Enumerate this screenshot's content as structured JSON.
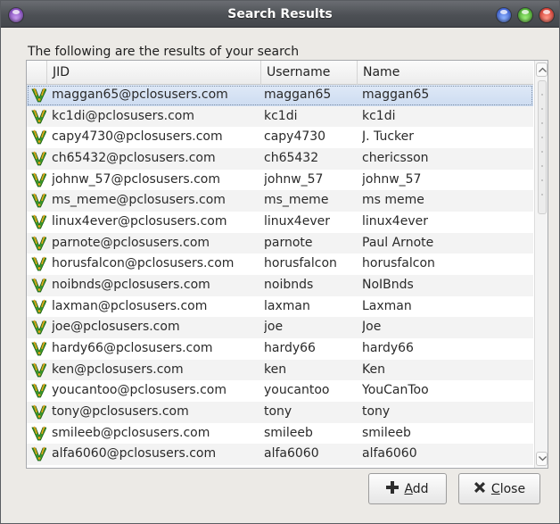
{
  "window": {
    "title": "Search Results"
  },
  "caption": "The following are the results of your search",
  "table": {
    "columns": [
      "JID",
      "Username",
      "Name"
    ],
    "rows": [
      {
        "jid": "maggan65@pclosusers.com",
        "username": "maggan65",
        "name": "maggan65",
        "selected": true
      },
      {
        "jid": "kc1di@pclosusers.com",
        "username": "kc1di",
        "name": "kc1di"
      },
      {
        "jid": "capy4730@pclosusers.com",
        "username": "capy4730",
        "name": "J. Tucker"
      },
      {
        "jid": "ch65432@pclosusers.com",
        "username": "ch65432",
        "name": "chericsson"
      },
      {
        "jid": "johnw_57@pclosusers.com",
        "username": "johnw_57",
        "name": "johnw_57"
      },
      {
        "jid": "ms_meme@pclosusers.com",
        "username": "ms_meme",
        "name": "ms meme"
      },
      {
        "jid": "linux4ever@pclosusers.com",
        "username": "linux4ever",
        "name": "linux4ever"
      },
      {
        "jid": "parnote@pclosusers.com",
        "username": "parnote",
        "name": "Paul Arnote"
      },
      {
        "jid": "horusfalcon@pclosusers.com",
        "username": "horusfalcon",
        "name": "horusfalcon"
      },
      {
        "jid": "noibnds@pclosusers.com",
        "username": "noibnds",
        "name": "NoIBnds"
      },
      {
        "jid": "laxman@pclosusers.com",
        "username": "laxman",
        "name": "Laxman"
      },
      {
        "jid": "joe@pclosusers.com",
        "username": "joe",
        "name": "Joe"
      },
      {
        "jid": "hardy66@pclosusers.com",
        "username": "hardy66",
        "name": "hardy66"
      },
      {
        "jid": "ken@pclosusers.com",
        "username": "ken",
        "name": "Ken"
      },
      {
        "jid": "youcantoo@pclosusers.com",
        "username": "youcantoo",
        "name": "YouCanToo"
      },
      {
        "jid": "tony@pclosusers.com",
        "username": "tony",
        "name": "tony"
      },
      {
        "jid": "smileeb@pclosusers.com",
        "username": "smileeb",
        "name": "smileeb"
      },
      {
        "jid": "alfa6060@pclosusers.com",
        "username": "alfa6060",
        "name": "alfa6060"
      }
    ]
  },
  "buttons": {
    "add": {
      "mnemonic": "A",
      "rest": "dd"
    },
    "close": {
      "mnemonic": "C",
      "rest": "lose"
    }
  },
  "icons": {
    "window_menu": "window-menu-icon",
    "minimize": "minimize-icon",
    "maximize": "maximize-icon",
    "close": "close-icon",
    "row": "jabber-contact-icon",
    "add": "plus-icon",
    "close_button": "x-icon"
  },
  "colors": {
    "titlebar": "#4d5055",
    "selection": "#cddcf1",
    "window_bg": "#eceae6"
  }
}
